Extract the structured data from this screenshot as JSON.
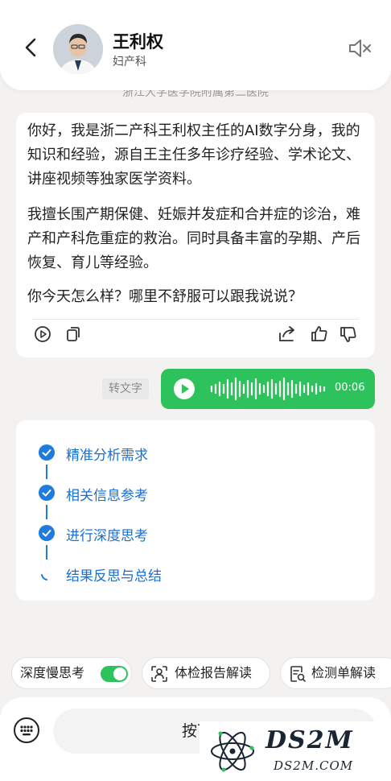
{
  "header": {
    "doctor_name": "王利权",
    "department": "妇产科",
    "hospital": "浙江大学医学院附属第二医院"
  },
  "intro": {
    "para1": "你好，我是浙二产科王利权主任的AI数字分身，我的知识和经验，源自王主任多年诊疗经验、学术论文、讲座视频等独家医学资料。",
    "para2": "我擅长围产期保健、妊娠并发症和合并症的诊治，难产和产科危重症的救治。同时具备丰富的孕期、产后恢复、育儿等经验。",
    "para3": "你今天怎么样？哪里不舒服可以跟我说说？"
  },
  "voice": {
    "convert_label": "转文字",
    "duration": "00:06"
  },
  "thinking": {
    "steps": [
      {
        "label": "精准分析需求",
        "status": "done"
      },
      {
        "label": "相关信息参考",
        "status": "done"
      },
      {
        "label": "进行深度思考",
        "status": "done"
      },
      {
        "label": "结果反思与总结",
        "status": "in-progress"
      }
    ]
  },
  "chips": {
    "deep_think": "深度慢思考",
    "deep_think_enabled": true,
    "report": "体检报告解读",
    "lab": "检测单解读"
  },
  "input": {
    "talk_label": "按下 说话"
  },
  "watermark": {
    "big": "DS2M",
    "small": "DS2M.COM"
  },
  "colors": {
    "accent_green": "#2ec25c",
    "accent_blue": "#1e7be0",
    "background": "#f4f2f0"
  }
}
